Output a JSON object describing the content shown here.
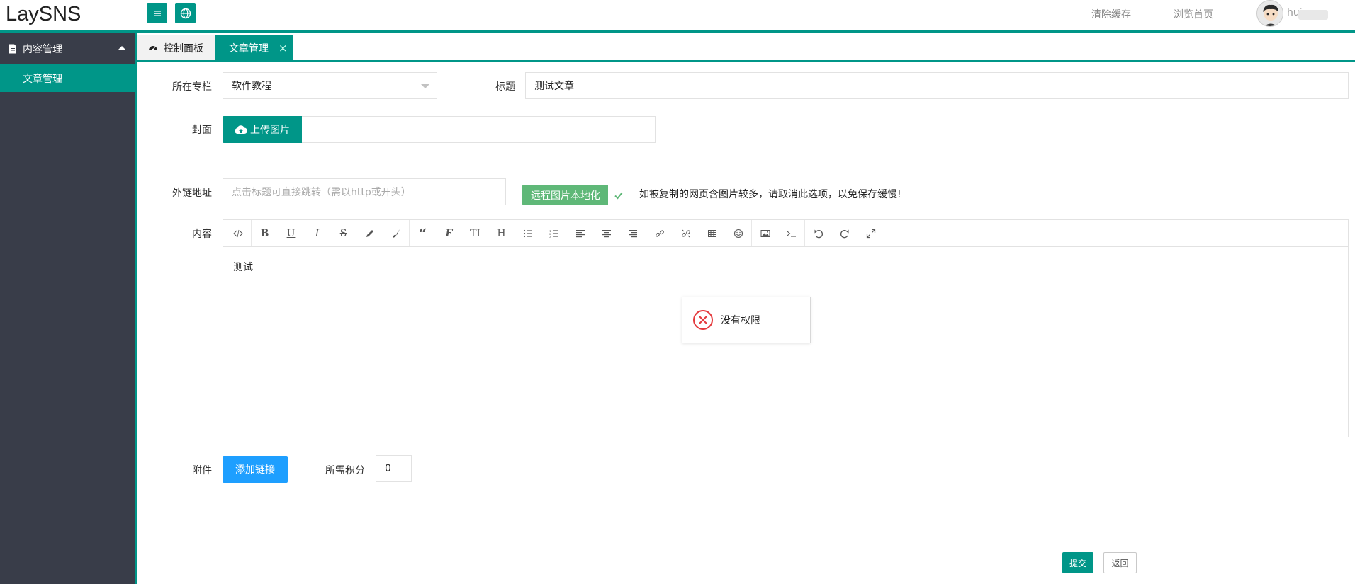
{
  "header": {
    "logo": "LaySNS",
    "clear_cache": "清除缓存",
    "browse_home": "浏览首页",
    "username": "hui",
    "accent_color": "#009688"
  },
  "sidebar": {
    "group": {
      "label": "内容管理",
      "icon": "document-icon"
    },
    "items": [
      {
        "label": "文章管理"
      }
    ]
  },
  "tabs": [
    {
      "label": "控制面板",
      "icon": "dashboard-icon"
    },
    {
      "label": "文章管理",
      "close": "×"
    }
  ],
  "form": {
    "column": {
      "label": "所在专栏",
      "value": "软件教程"
    },
    "title": {
      "label": "标题",
      "value": "测试文章"
    },
    "cover": {
      "label": "封面",
      "button": "上传图片"
    },
    "external": {
      "label": "外链地址",
      "placeholder": "点击标题可直接跳转（需以http或开头）"
    },
    "localize": {
      "label": "远程图片本地化",
      "checked": true,
      "hint": "如被复制的网页含图片较多，请取消此选项，以免保存缓慢!"
    },
    "content": {
      "label": "内容",
      "text": "测试"
    },
    "attachment": {
      "label": "附件",
      "button": "添加链接"
    },
    "points": {
      "label": "所需积分",
      "value": "0"
    }
  },
  "toolbar": {
    "icons": [
      "code-icon",
      "bold-icon",
      "underline-icon",
      "italic-icon",
      "strikethrough-icon",
      "pencil-icon",
      "brush-icon",
      "quote-icon",
      "font-icon",
      "font-size-icon",
      "heading-icon",
      "unordered-list-icon",
      "ordered-list-icon",
      "align-left-icon",
      "align-center-icon",
      "align-right-icon",
      "link-icon",
      "unlink-icon",
      "table-icon",
      "emoji-icon",
      "image-icon",
      "terminal-icon",
      "undo-icon",
      "redo-icon",
      "fullscreen-icon"
    ]
  },
  "modal": {
    "message": "没有权限",
    "icon": "error-icon"
  },
  "actions": {
    "submit": "提交",
    "back": "返回"
  }
}
